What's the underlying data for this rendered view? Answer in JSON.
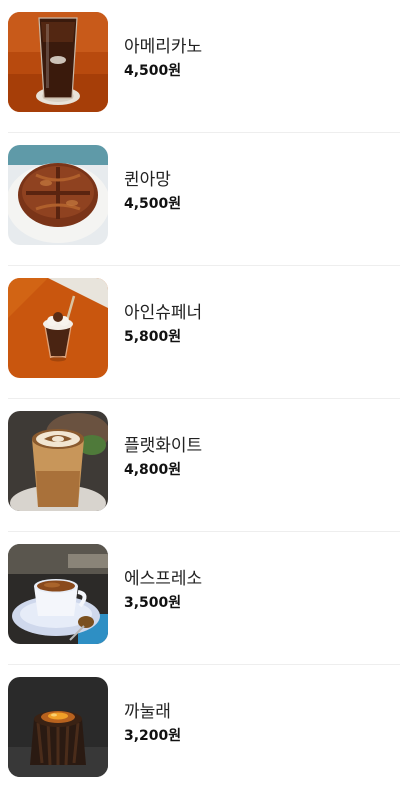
{
  "menu": {
    "items": [
      {
        "name": "아메리카노",
        "price": "4,500원",
        "icon": "iced-americano-photo"
      },
      {
        "name": "퀸아망",
        "price": "4,500원",
        "icon": "kouign-amann-photo"
      },
      {
        "name": "아인슈페너",
        "price": "5,800원",
        "icon": "einspanner-photo"
      },
      {
        "name": "플랫화이트",
        "price": "4,800원",
        "icon": "flat-white-photo"
      },
      {
        "name": "에스프레소",
        "price": "3,500원",
        "icon": "espresso-photo"
      },
      {
        "name": "까눌래",
        "price": "3,200원",
        "icon": "canele-photo"
      }
    ]
  }
}
